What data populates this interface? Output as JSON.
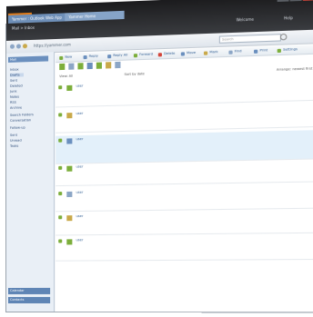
{
  "window": {
    "tabs": [
      "Yammer : Outlook Web App",
      "Yammer Home"
    ],
    "mailbox": "Mail > Inbox",
    "welcome": "Welcome",
    "help": "Help",
    "address": "https://yammer.com",
    "search_placeholder": "Search"
  },
  "leftnav": {
    "header": "Mail",
    "items": [
      "Inbox",
      "Drafts",
      "Sent",
      "Deleted",
      "Junk",
      "Notes",
      "RSS",
      "Archive",
      "Search Folders",
      "Conversation",
      "Follow-up",
      "Sent",
      "Unread",
      "Tasks"
    ],
    "selected_index": 1,
    "bottom": [
      "Calendar",
      "Contacts"
    ]
  },
  "toolbar": {
    "items": [
      "New",
      "Reply",
      "Reply All",
      "Forward",
      "Delete",
      "Move",
      "Mark",
      "Find",
      "Print",
      "Settings"
    ]
  },
  "filter": {
    "view": "View: All",
    "sort": "Sort by date",
    "arrange": "Arrange: newest first"
  },
  "posts": [
    {
      "author": "user",
      "meta": "",
      "text": "",
      "highlight": false
    },
    {
      "author": "user",
      "meta": "",
      "text": "",
      "highlight": false
    },
    {
      "author": "user",
      "meta": "",
      "text": "",
      "highlight": true
    },
    {
      "author": "user",
      "meta": "",
      "text": "",
      "highlight": false
    },
    {
      "author": "user",
      "meta": "",
      "text": "",
      "highlight": false
    },
    {
      "author": "user",
      "meta": "",
      "text": "",
      "highlight": false
    },
    {
      "author": "user",
      "meta": "",
      "text": "",
      "highlight": false
    }
  ],
  "colors": {
    "accent": "#6a8fbe",
    "link": "#2b5a91",
    "highlight": "#e3f0fa",
    "close": "#d2453a",
    "orange": "#e07b1a",
    "green": "#7cae3b"
  }
}
